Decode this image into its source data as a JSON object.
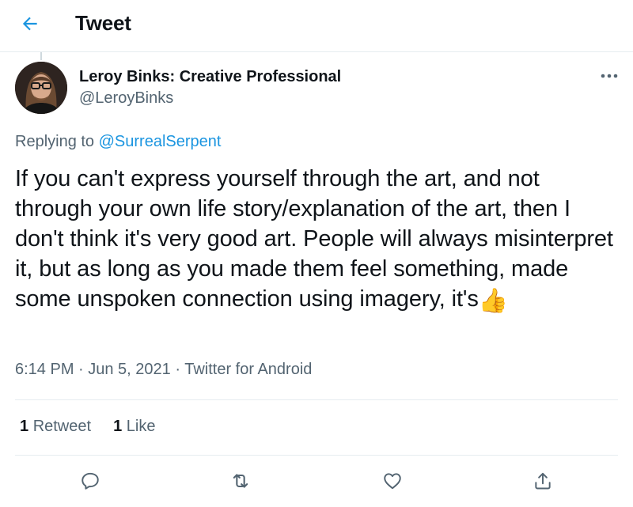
{
  "header": {
    "title": "Tweet",
    "back_icon": "arrow-left-icon",
    "accent_color": "#1b95e0"
  },
  "tweet": {
    "author": {
      "display_name": "Leroy Binks: Creative Professional",
      "handle": "@LeroyBinks"
    },
    "more_icon": "more-dots-icon",
    "replying_prefix": "Replying to",
    "replying_to": "@SurrealSerpent",
    "text": "If you can't express yourself through the art, and not through your own life story/explanation of the art, then I don't think it's very good art. People will always misinterpret it, but as long as you made them feel something, made some unspoken connection using imagery, it's",
    "emoji": "👍",
    "timestamp": "6:14 PM · Jun 5, 2021 · ",
    "client": "Twitter for Android",
    "stats": {
      "retweets_count": "1",
      "retweets_label": "Retweet",
      "likes_count": "1",
      "likes_label": "Like"
    },
    "actions": [
      {
        "name": "reply",
        "icon": "reply-icon"
      },
      {
        "name": "retweet",
        "icon": "retweet-icon"
      },
      {
        "name": "like",
        "icon": "heart-icon"
      },
      {
        "name": "share",
        "icon": "share-icon"
      }
    ]
  }
}
